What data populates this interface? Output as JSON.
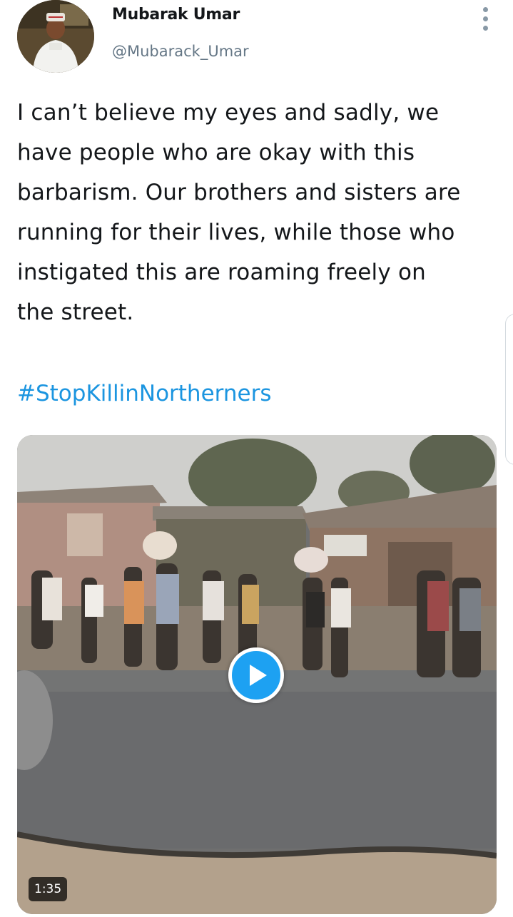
{
  "tweet": {
    "author": {
      "display_name": "Mubarak Umar",
      "handle": "@Mubarack_Umar",
      "avatar_icon": "profile-photo"
    },
    "more_icon": "more-vertical-icon",
    "text_lines": [
      "I can’t believe my eyes and sadly, we",
      "have people who are okay with this",
      "barbarism. Our brothers and sisters are",
      "running for their lives, while those who",
      "instigated this are roaming freely on",
      "the street."
    ],
    "hashtag": "#StopKillinNortherners",
    "media": {
      "type": "video",
      "duration": "1:35",
      "play_icon": "play-icon"
    }
  },
  "colors": {
    "text": "#14171a",
    "secondary": "#657786",
    "link": "#1b95e0",
    "play_button": "#1da1f2"
  }
}
